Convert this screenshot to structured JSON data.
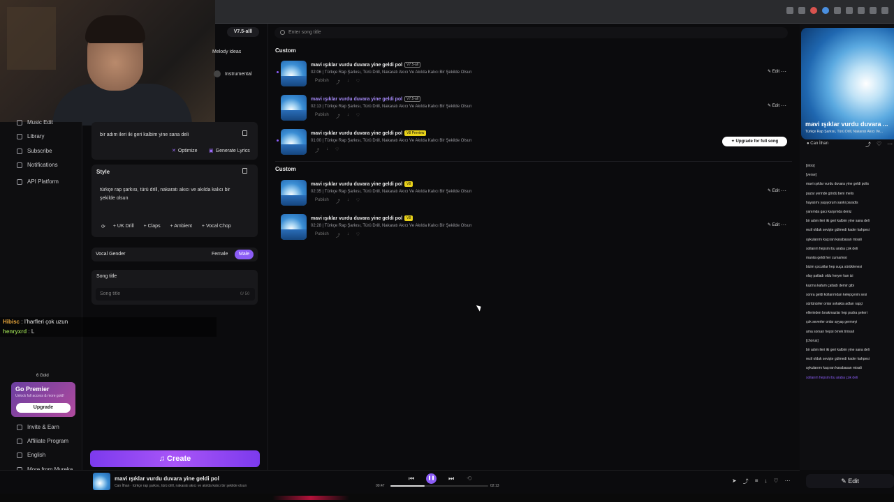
{
  "header": {
    "model": "V7.5-alll"
  },
  "create_panel": {
    "melody_ideas": "Melody ideas",
    "instrumental": "Instrumental",
    "lyrics_text": "bir adım ileri iki geri kalbim yine sana deli",
    "optimize": "Optimize",
    "generate_lyrics": "Generate Lyrics",
    "style_label": "Style",
    "style_text": "türkçe rap şarkısı, türü drill, nakaratı akıcı ve akılda kalıcı bir şekilde olsun",
    "tags": [
      "+ UK Drill",
      "+ Claps",
      "+ Ambient",
      "+ Vocal Chop"
    ],
    "vocal_gender_label": "Vocal Gender",
    "female": "Female",
    "male": "Male",
    "song_title_label": "Song title",
    "song_title_placeholder": "Song title",
    "song_title_count": "0/ 50",
    "create": "Create"
  },
  "sidebar": {
    "items": [
      "Music Edit",
      "Library",
      "Subscribe",
      "Notifications",
      "API Platform"
    ],
    "gold": "6 Gold",
    "premium_title": "Go Premier",
    "premium_sub": "Unlock full access & more gold!",
    "upgrade": "Upgrade",
    "bottom_items": [
      "Invite & Earn",
      "Affiliate Program",
      "English",
      "More from Mureka"
    ]
  },
  "chat": [
    {
      "user": "Hibisc",
      "text": ": I'harfleri çok uzun"
    },
    {
      "user": "henryxrd",
      "text": ": L"
    }
  ],
  "main": {
    "search_placeholder": "Enter song title",
    "section1": "Custom",
    "section2": "Custom",
    "upgrade_full": "Upgrade for full song",
    "songs": [
      {
        "title": "mavi ışıklar vurdu duvara yine geldi pol",
        "ver": "V7.5-all",
        "meta": "02:06 | Türkçe Rap Şarkısı, Türü Drill, Nakaratı Akıcı Ve Akılda Kalıcı Bir Şekilde Olsun",
        "publish": "Publish",
        "edit": "Edit"
      },
      {
        "title": "mavi ışıklar vurdu duvara yine geldi pol",
        "ver": "V7.5-all",
        "meta": "02:13 | Türkçe Rap Şarkısı, Türü Drill, Nakaratı Akıcı Ve Akılda Kalıcı Bir Şekilde Olsun",
        "publish": "Publish",
        "edit": "Edit"
      },
      {
        "title": "mavi ışıklar vurdu duvara yine geldi pol",
        "ver": "V8 Preview",
        "meta": "01:00 | Türkçe Rap Şarkısı, Türü Drill, Nakaratı Akıcı Ve Akılda Kalıcı Bir Şekilde Olsun",
        "publish": "",
        "edit": ""
      },
      {
        "title": "mavi ışıklar vurdu duvara yine geldi pol",
        "ver": "V8",
        "meta": "02:35 | Türkçe Rap Şarkısı, Türü Drill, Nakaratı Akıcı Ve Akılda Kalıcı Bir Şekilde Olsun",
        "publish": "Publish",
        "edit": "Edit"
      },
      {
        "title": "mavi ışıklar vurdu duvara yine geldi pol",
        "ver": "V8",
        "meta": "02:28 | Türkçe Rap Şarkısı, Türü Drill, Nakaratı Akıcı Ve Akılda Kalıcı Bir Şekilde Olsun",
        "publish": "Publish",
        "edit": "Edit"
      }
    ]
  },
  "right_panel": {
    "title": "mavi ışıklar vurdu duvara ...",
    "subtitle": "Türkçe Rap Şarkısı, Türü Drill, Nakaratı Akıcı Ve...",
    "author": "Can İlhan",
    "edit": "Edit",
    "lyrics": [
      "[intro]",
      "[verse]",
      "mavi ışıklar vurdu duvara yine geldi polis",
      "pazar yerinde gördü beni melis",
      "hayatımı yaşıyorum sanki paradis",
      "yanımda gacı karşımda deniz",
      "bir adım ileri iki geri kalbim yine sana deli",
      "rezil olduk sevişte gülmedi kader kahpesi",
      "uykularımı kaçıran karabasan misali",
      "sollarım hepsini bu araba çok deli",
      "manita geldi her cumartesi",
      "bizim çocuklar hep suça sürüklenesi",
      "olay patladı oldu heryer kan izi",
      "kazma kafam çatladı demir gibi",
      "sonra geldi kollarımdan kelepçenin sesi",
      "sürtünürler onlar sokakta adları rapçi",
      "ellerinden bırakmazlar hep pudra şekeri",
      "çok severler onlar ayyaş germeyi",
      "ama sorsan hepsi örnek timsali",
      "[chorus]",
      "bir adım ileri iki geri kalbim yine sana deli",
      "rezil olduk sevişte gülmedi kader kahpesi",
      "uykularımı kaçıran karabasan misali",
      "sollarım hepsini bu araba çok deli"
    ]
  },
  "player": {
    "title": "mavi ışıklar vurdu duvara yine geldi pol",
    "subtitle": "Can İlhan · türkçe rap şarkısı, türü drill, nakaratı akıcı ve akılda kalıcı bir şekilde olsun",
    "current": "00:47",
    "total": "02:13",
    "progress": 0.35
  }
}
